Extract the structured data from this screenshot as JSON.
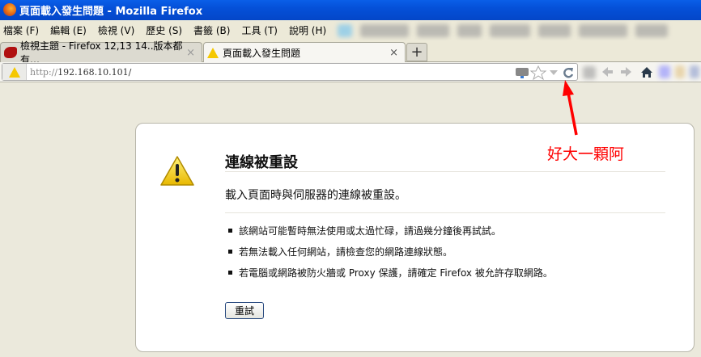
{
  "window": {
    "title": "頁面載入發生問題 - Mozilla Firefox"
  },
  "menu": [
    "檔案 (F)",
    "編輯 (E)",
    "檢視 (V)",
    "歷史 (S)",
    "書籤 (B)",
    "工具 (T)",
    "說明 (H)"
  ],
  "tabs": [
    {
      "label": "檢視主題 - Firefox 12,13 14..版本都有…",
      "close": "×"
    },
    {
      "label": "頁面載入發生問題",
      "close": "×"
    }
  ],
  "newtab": "+",
  "url": {
    "protocol": "http://",
    "rest": "192.168.10.101/"
  },
  "error": {
    "title": "連線被重設",
    "description": "載入頁面時與伺服器的連線被重設。",
    "items": [
      "該網站可能暫時無法使用或太過忙碌，請過幾分鐘後再試試。",
      "若無法載入任何網站，請檢查您的網路連線狀態。",
      "若電腦或網路被防火牆或 Proxy 保護，請確定 Firefox 被允許存取網路。"
    ],
    "retry": "重試"
  },
  "annotation": {
    "text": "好大一顆阿",
    "color": "#ff0000"
  }
}
